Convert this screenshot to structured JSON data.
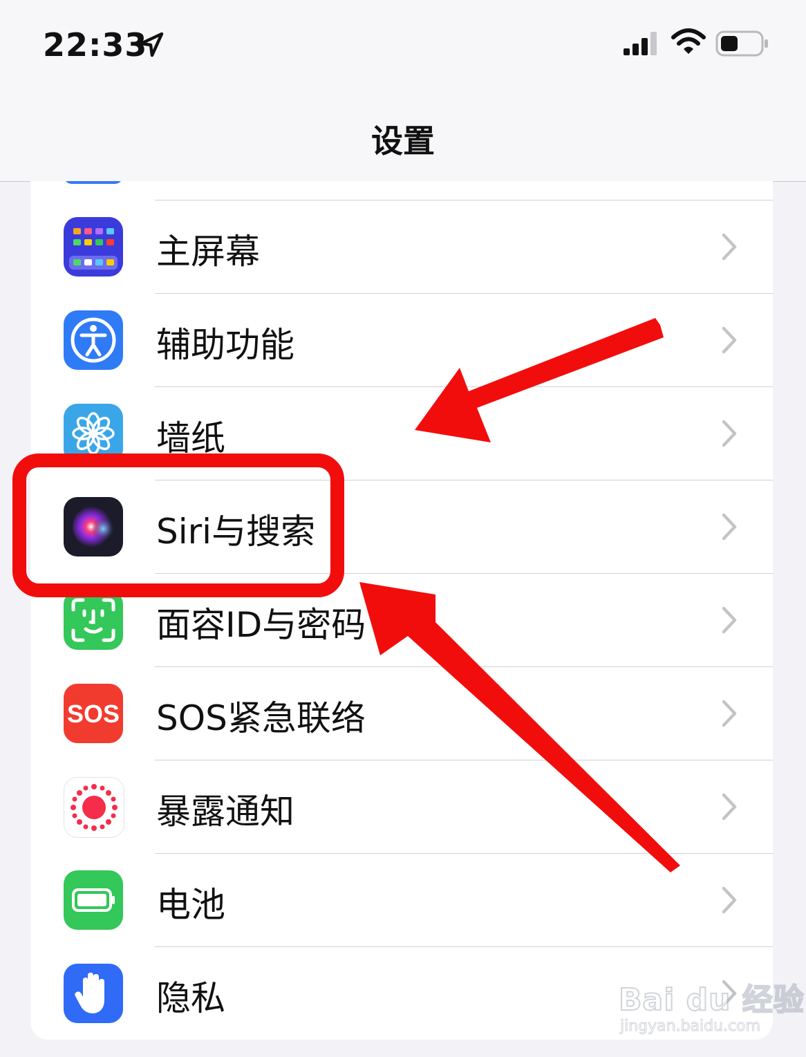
{
  "status_bar": {
    "time": "22:33"
  },
  "nav": {
    "title": "设置"
  },
  "rows": [
    {
      "label": "主屏幕",
      "icon": "home-screen-icon",
      "color": "#3b3bdc"
    },
    {
      "label": "辅助功能",
      "icon": "accessibility-icon",
      "color": "#2f7bf6"
    },
    {
      "label": "墙纸",
      "icon": "wallpaper-icon",
      "color": "#3aa6e8"
    },
    {
      "label": "Siri与搜索",
      "icon": "siri-icon",
      "color": "#1b1b2a"
    },
    {
      "label": "面容ID与密码",
      "icon": "face-id-icon",
      "color": "#34c759"
    },
    {
      "label": "SOS紧急联络",
      "icon": "sos-icon",
      "color": "#f23b2f",
      "icon_text": "SOS"
    },
    {
      "label": "暴露通知",
      "icon": "exposure-notification-icon",
      "color": "#ffffff"
    },
    {
      "label": "电池",
      "icon": "battery-settings-icon",
      "color": "#34c759"
    },
    {
      "label": "隐私",
      "icon": "privacy-hand-icon",
      "color": "#2f6bf6"
    }
  ],
  "annotation": {
    "color": "#f20d0d"
  },
  "watermark": {
    "logo": "Bai du 经验",
    "url": "jingyan.baidu.com"
  }
}
